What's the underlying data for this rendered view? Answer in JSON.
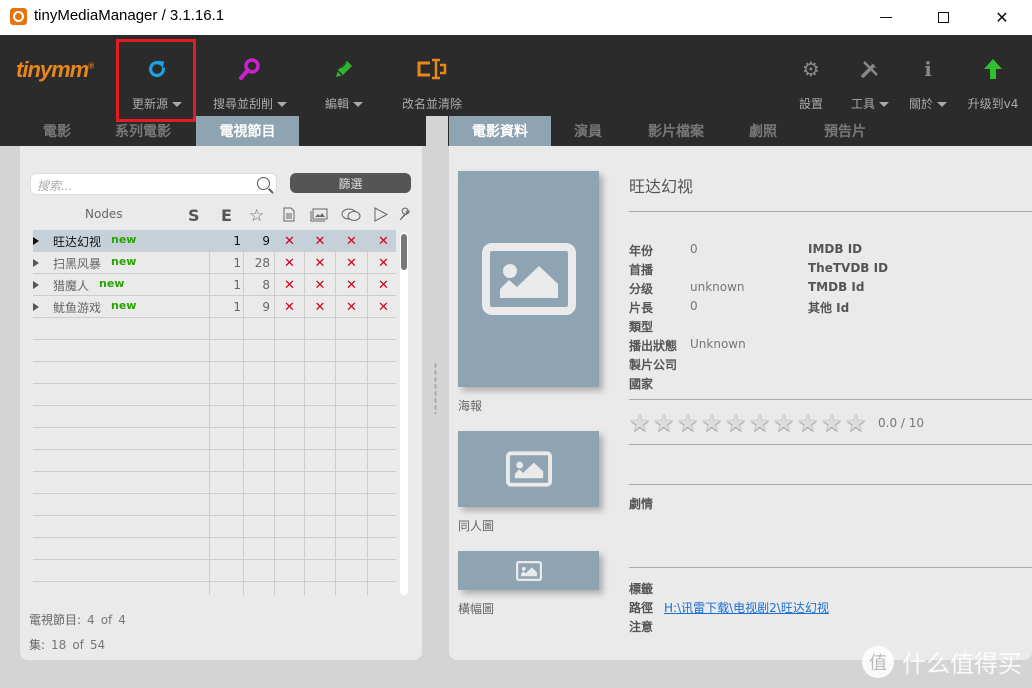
{
  "window": {
    "title": "tinyMediaManager / 3.1.16.1",
    "controls": [
      "minimize",
      "maximize",
      "close"
    ]
  },
  "toolbar": {
    "logo": "tinymm",
    "left_buttons": [
      {
        "label": "更新源",
        "icon": "refresh-icon",
        "dropdown": true,
        "color": "#1ea0e6"
      },
      {
        "label": "搜尋並刮削",
        "icon": "search-icon",
        "dropdown": true,
        "color": "#cc22cc"
      },
      {
        "label": "編輯",
        "icon": "edit-icon",
        "dropdown": true,
        "color": "#2db52d"
      },
      {
        "label": "改名並清除",
        "icon": "rename-icon",
        "dropdown": false,
        "color": "#e8851b"
      }
    ],
    "right_buttons": [
      {
        "label": "設置",
        "icon": "gear-icon",
        "dropdown": false
      },
      {
        "label": "工具",
        "icon": "wrench-icon",
        "dropdown": true
      },
      {
        "label": "關於",
        "icon": "info-icon",
        "dropdown": true
      },
      {
        "label": "升级到v4",
        "icon": "upgrade-arrow-icon",
        "dropdown": false,
        "color": "#2fc02f"
      }
    ]
  },
  "left_tabs": [
    {
      "label": "電影",
      "active": false
    },
    {
      "label": "系列電影",
      "active": false
    },
    {
      "label": "電視節目",
      "active": true
    }
  ],
  "right_tabs": [
    {
      "label": "電影資料",
      "active": true
    },
    {
      "label": "演員",
      "active": false
    },
    {
      "label": "影片檔案",
      "active": false
    },
    {
      "label": "劇照",
      "active": false
    },
    {
      "label": "預告片",
      "active": false
    }
  ],
  "search": {
    "placeholder": "搜索...",
    "value": ""
  },
  "filter_button": "篩選",
  "table": {
    "columns": {
      "nodes": "Nodes",
      "s": "S",
      "e": "E",
      "icons": [
        "star-icon",
        "nfo-document-icon",
        "images-icon",
        "subtitles-icon",
        "trailer-play-icon",
        "wrench-icon"
      ]
    },
    "rows": [
      {
        "name": "旺达幻视",
        "badge": "new",
        "s": "1",
        "e": "9",
        "flags": [
          "",
          "✕",
          "✕",
          "✕",
          "✕"
        ],
        "selected": true
      },
      {
        "name": "扫黑风暴",
        "badge": "new",
        "s": "1",
        "e": "28",
        "flags": [
          "",
          "✕",
          "✕",
          "✕",
          "✕"
        ],
        "selected": false
      },
      {
        "name": "猎魔人",
        "badge": "new",
        "s": "1",
        "e": "8",
        "flags": [
          "",
          "✕",
          "✕",
          "✕",
          "✕"
        ],
        "selected": false
      },
      {
        "name": "鱿鱼游戏",
        "badge": "new",
        "s": "1",
        "e": "9",
        "flags": [
          "",
          "✕",
          "✕",
          "✕",
          "✕"
        ],
        "selected": false
      }
    ]
  },
  "status": {
    "shows_label": "電視節目:",
    "shows_count": "4",
    "shows_of": "of",
    "shows_total": "4",
    "episodes_label": "集:",
    "episodes_count": "18",
    "episodes_of": "of",
    "episodes_total": "54"
  },
  "detail": {
    "title": "旺达幻视",
    "poster_label": "海報",
    "fanart_label": "同人圖",
    "banner_label": "橫幅圖",
    "fields": [
      {
        "label": "年份",
        "value": "0"
      },
      {
        "label": "首播",
        "value": ""
      },
      {
        "label": "分级",
        "value": "unknown"
      },
      {
        "label": "片長",
        "value": "0"
      },
      {
        "label": "類型",
        "value": ""
      },
      {
        "label": "播出狀態",
        "value": "Unknown"
      },
      {
        "label": "製片公司",
        "value": ""
      },
      {
        "label": "國家",
        "value": ""
      }
    ],
    "ids": [
      {
        "label": "IMDB ID",
        "value": ""
      },
      {
        "label": "TheTVDB ID",
        "value": ""
      },
      {
        "label": "TMDB Id",
        "value": ""
      },
      {
        "label": "其他 Id",
        "value": ""
      }
    ],
    "rating": {
      "value": 0.0,
      "max": 10,
      "text": "0.0 / 10",
      "stars": 10
    },
    "plot_label": "劇情",
    "plot": "",
    "tags_label": "標籤",
    "path_label": "路徑",
    "path": "H:\\讯雷下载\\电视剧2\\旺达幻视",
    "note_label": "注意"
  },
  "watermark": {
    "icon": "值",
    "text": "什么值得买"
  }
}
